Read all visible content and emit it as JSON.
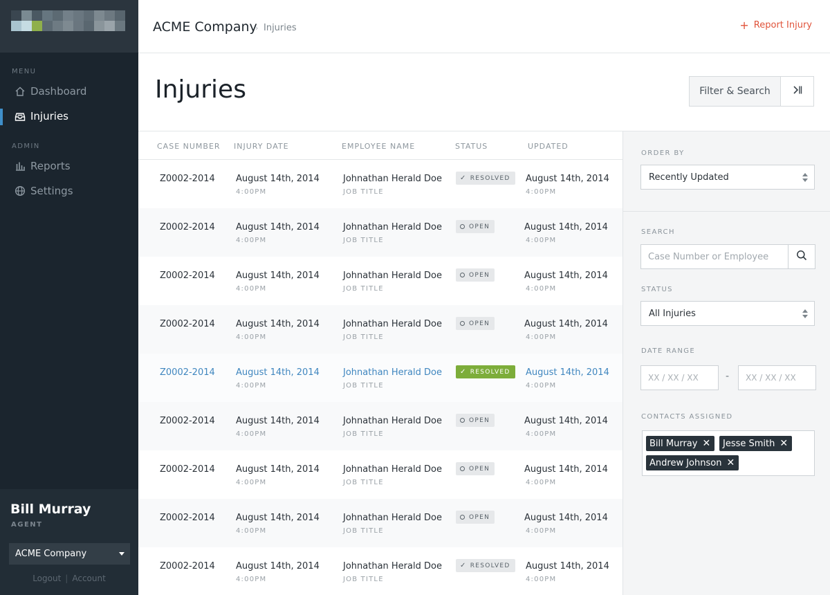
{
  "colors": {
    "sidebar_bg": "#1b252e",
    "accent_blue": "#3f8fc9",
    "report_red": "#e0533a",
    "resolved_green": "#7dad3a"
  },
  "sidebar": {
    "logo_icon": "logo-pixel-blocks",
    "menu_heading": "MENU",
    "admin_heading": "ADMIN",
    "menu_items": [
      {
        "label": "Dashboard",
        "icon": "home-icon",
        "active": false
      },
      {
        "label": "Injuries",
        "icon": "inbox-icon",
        "active": true
      }
    ],
    "admin_items": [
      {
        "label": "Reports",
        "icon": "bar-chart-icon",
        "active": false
      },
      {
        "label": "Settings",
        "icon": "globe-icon",
        "active": false
      }
    ],
    "user": {
      "name": "Bill Murray",
      "role": "AGENT",
      "company": "ACME Company",
      "logout": "Logout",
      "account": "Account"
    }
  },
  "header": {
    "company": "ACME Company",
    "separator": "›",
    "page": "Injuries",
    "report_plus": "+",
    "report_label": "Report Injury"
  },
  "page": {
    "title": "Injuries",
    "filter_button": "Filter & Search"
  },
  "table": {
    "columns": [
      "CASE NUMBER",
      "INJURY DATE",
      "EMPLOYEE NAME",
      "STATUS",
      "UPDATED"
    ],
    "rows": [
      {
        "case": "Z0002-2014",
        "date": "August 14th, 2014",
        "time": "4:00PM",
        "name": "Johnathan Herald Doe",
        "job": "JOB TITLE",
        "status": "RESOLVED",
        "updated": "August 14th, 2014",
        "updated_time": "4:00PM"
      },
      {
        "case": "Z0002-2014",
        "date": "August 14th, 2014",
        "time": "4:00PM",
        "name": "Johnathan Herald Doe",
        "job": "JOB TITLE",
        "status": "OPEN",
        "updated": "August 14th, 2014",
        "updated_time": "4:00PM"
      },
      {
        "case": "Z0002-2014",
        "date": "August 14th, 2014",
        "time": "4:00PM",
        "name": "Johnathan Herald Doe",
        "job": "JOB TITLE",
        "status": "OPEN",
        "updated": "August 14th, 2014",
        "updated_time": "4:00PM"
      },
      {
        "case": "Z0002-2014",
        "date": "August 14th, 2014",
        "time": "4:00PM",
        "name": "Johnathan Herald Doe",
        "job": "JOB TITLE",
        "status": "OPEN",
        "updated": "August 14th, 2014",
        "updated_time": "4:00PM"
      },
      {
        "case": "Z0002-2014",
        "date": "August 14th, 2014",
        "time": "4:00PM",
        "name": "Johnathan Herald Doe",
        "job": "JOB TITLE",
        "status": "RESOLVED",
        "updated": "August 14th, 2014",
        "updated_time": "4:00PM",
        "selected": true
      },
      {
        "case": "Z0002-2014",
        "date": "August 14th, 2014",
        "time": "4:00PM",
        "name": "Johnathan Herald Doe",
        "job": "JOB TITLE",
        "status": "OPEN",
        "updated": "August 14th, 2014",
        "updated_time": "4:00PM"
      },
      {
        "case": "Z0002-2014",
        "date": "August 14th, 2014",
        "time": "4:00PM",
        "name": "Johnathan Herald Doe",
        "job": "JOB TITLE",
        "status": "OPEN",
        "updated": "August 14th, 2014",
        "updated_time": "4:00PM"
      },
      {
        "case": "Z0002-2014",
        "date": "August 14th, 2014",
        "time": "4:00PM",
        "name": "Johnathan Herald Doe",
        "job": "JOB TITLE",
        "status": "OPEN",
        "updated": "August 14th, 2014",
        "updated_time": "4:00PM"
      },
      {
        "case": "Z0002-2014",
        "date": "August 14th, 2014",
        "time": "4:00PM",
        "name": "Johnathan Herald Doe",
        "job": "JOB TITLE",
        "status": "RESOLVED",
        "updated": "August 14th, 2014",
        "updated_time": "4:00PM"
      }
    ]
  },
  "filters": {
    "order_by_label": "ORDER BY",
    "order_by_value": "Recently Updated",
    "search_label": "SEARCH",
    "search_placeholder": "Case Number or Employee",
    "status_label": "STATUS",
    "status_value": "All Injuries",
    "date_range_label": "DATE RANGE",
    "date_from_placeholder": "XX / XX / XX",
    "date_to_placeholder": "XX / XX / XX",
    "date_separator": "-",
    "contacts_label": "CONTACTS ASSIGNED",
    "contacts": [
      "Bill Murray",
      "Jesse Smith",
      "Andrew Johnson"
    ],
    "remove_glyph": "✕"
  }
}
